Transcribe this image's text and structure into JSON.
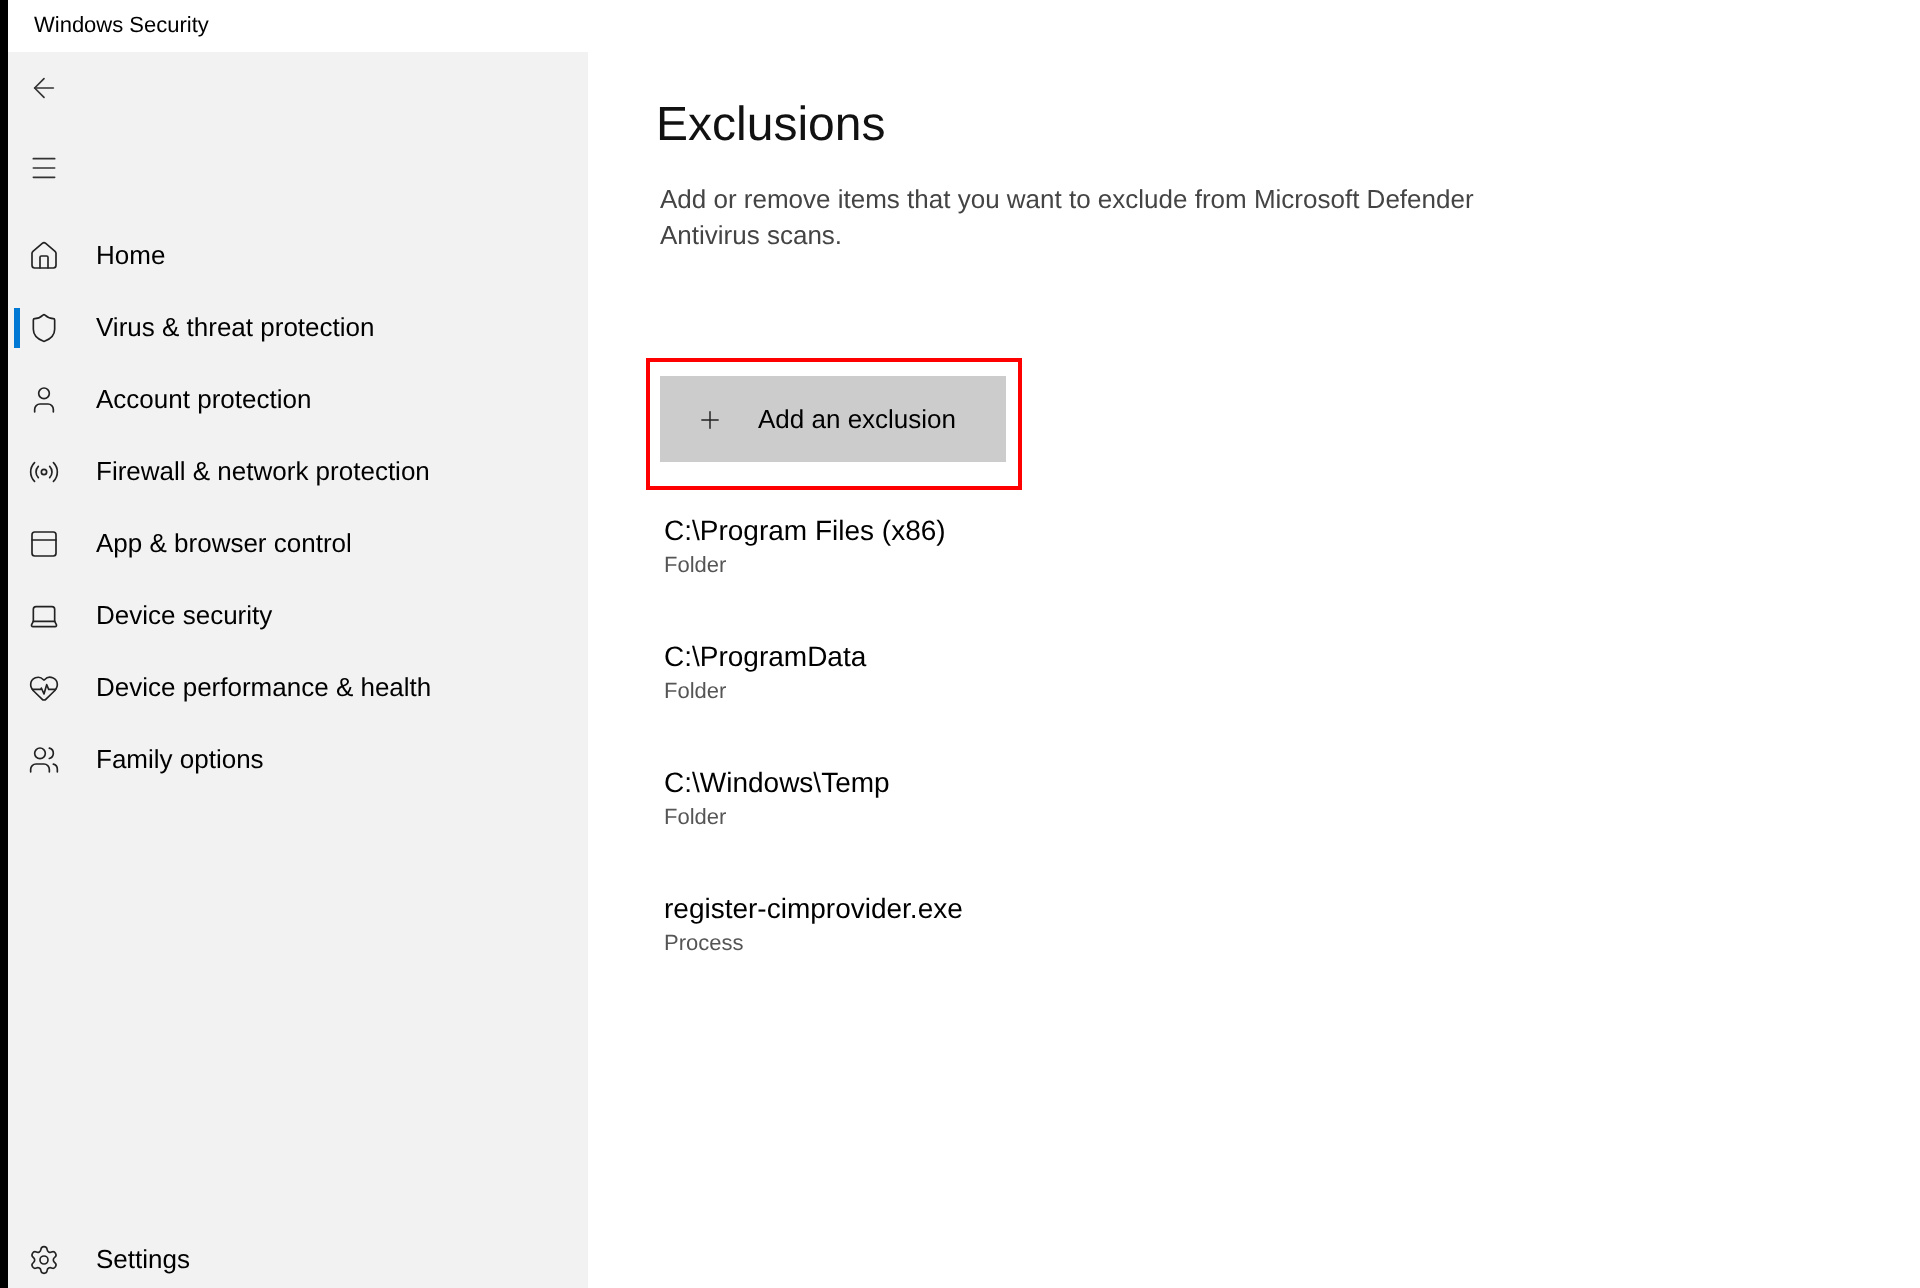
{
  "window": {
    "title": "Windows Security"
  },
  "sidebar": {
    "items": [
      {
        "label": "Home",
        "selected": false
      },
      {
        "label": "Virus & threat protection",
        "selected": true
      },
      {
        "label": "Account protection",
        "selected": false
      },
      {
        "label": "Firewall & network protection",
        "selected": false
      },
      {
        "label": "App & browser control",
        "selected": false
      },
      {
        "label": "Device security",
        "selected": false
      },
      {
        "label": "Device performance & health",
        "selected": false
      },
      {
        "label": "Family options",
        "selected": false
      }
    ],
    "footer_items": [
      {
        "label": "Settings",
        "selected": false
      }
    ]
  },
  "page": {
    "title": "Exclusions",
    "description": "Add or remove items that you want to exclude from Microsoft Defender Antivirus scans.",
    "add_button": {
      "label": "Add an exclusion",
      "highlighted": true
    },
    "exclusions": [
      {
        "path": "C:\\Program Files (x86)",
        "type": "Folder"
      },
      {
        "path": "C:\\ProgramData",
        "type": "Folder"
      },
      {
        "path": "C:\\Windows\\Temp",
        "type": "Folder"
      },
      {
        "path": "register-cimprovider.exe",
        "type": "Process"
      }
    ]
  }
}
